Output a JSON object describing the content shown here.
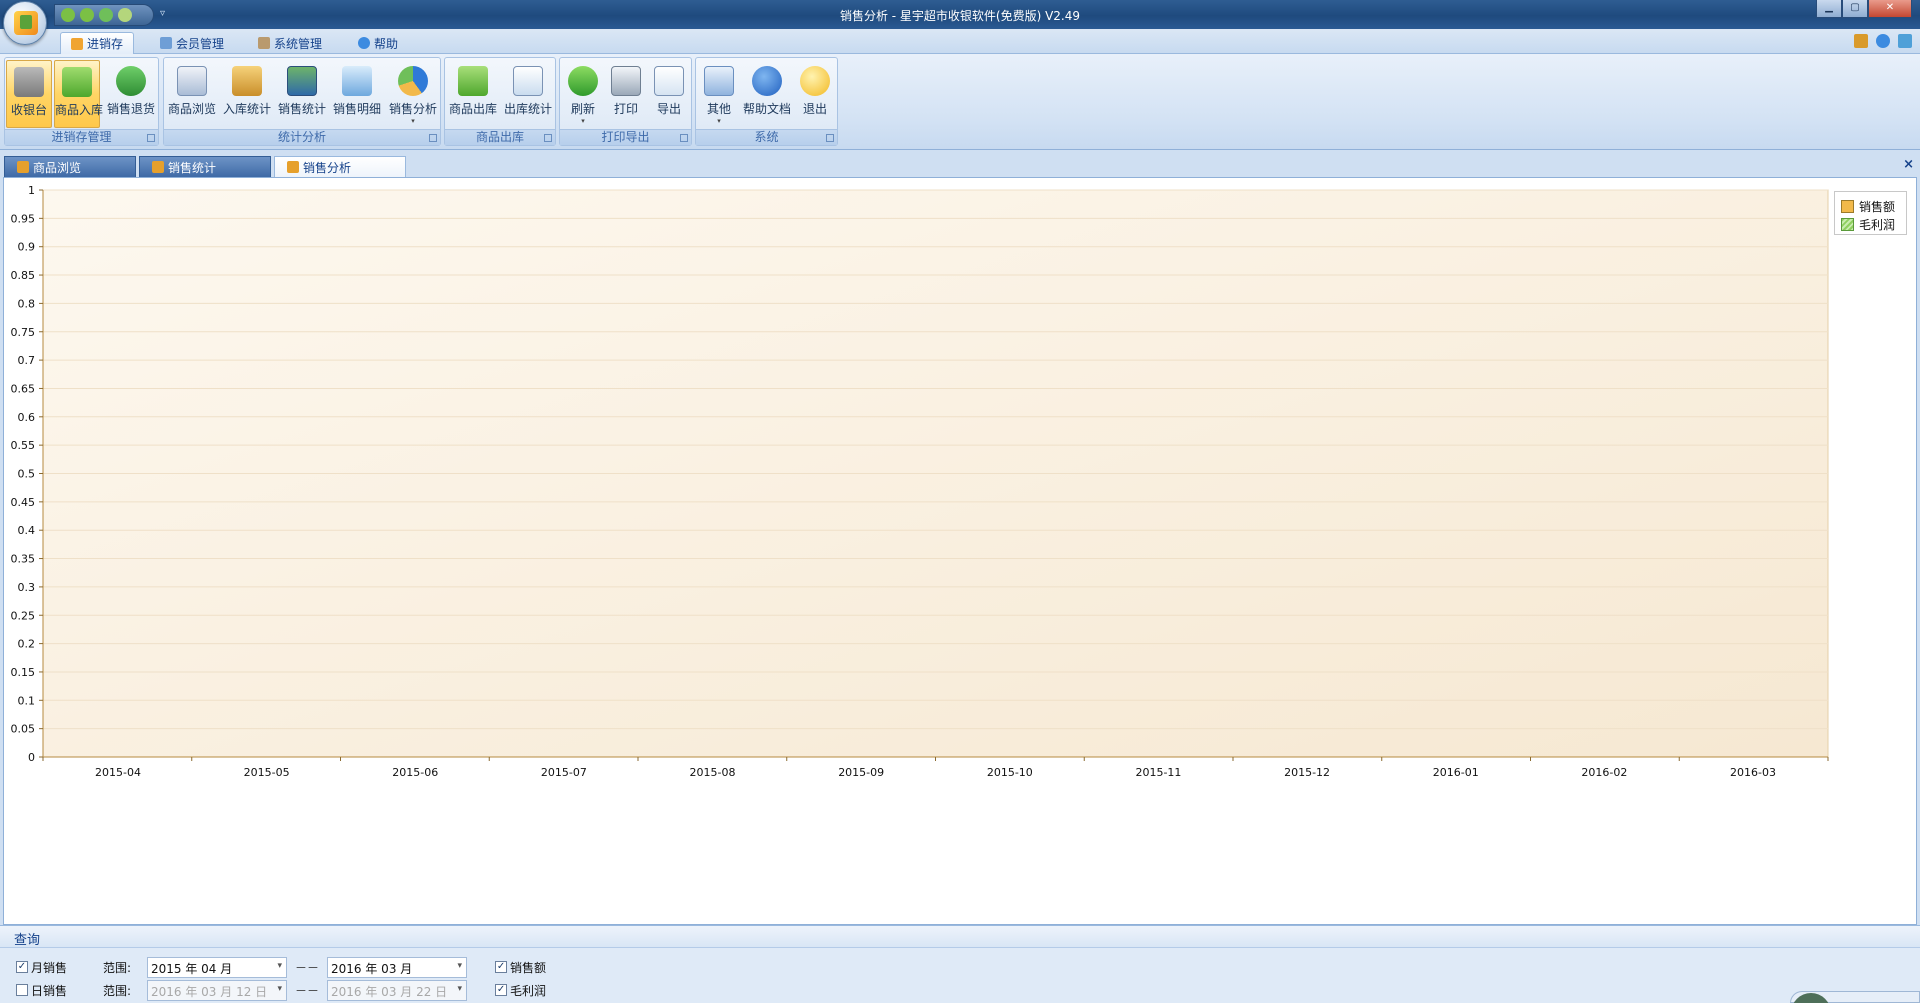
{
  "window": {
    "title": "销售分析 - 星宇超市收银软件(免费版) V2.49",
    "minimize": "▁",
    "maximize": "▢",
    "close": "✕",
    "qat_dropdown": "▿"
  },
  "ribbon_tabs": [
    "进销存",
    "会员管理",
    "系统管理",
    "帮助"
  ],
  "ribbon": {
    "groups": [
      {
        "label": "进销存管理",
        "buttons": [
          "收银台",
          "商品入库",
          "销售退货"
        ]
      },
      {
        "label": "统计分析",
        "buttons": [
          "商品浏览",
          "入库统计",
          "销售统计",
          "销售明细",
          "销售分析"
        ]
      },
      {
        "label": "商品出库",
        "buttons": [
          "商品出库",
          "出库统计"
        ]
      },
      {
        "label": "打印导出",
        "buttons": [
          "刷新",
          "打印",
          "导出"
        ]
      },
      {
        "label": "系统",
        "buttons": [
          "其他",
          "帮助文档",
          "退出"
        ]
      }
    ],
    "dropdown_arrow": "▾"
  },
  "doc_tabs": [
    "商品浏览",
    "销售统计",
    "销售分析"
  ],
  "doc_close": "×",
  "chart_data": {
    "type": "bar",
    "categories": [
      "2015-04",
      "2015-05",
      "2015-06",
      "2015-07",
      "2015-08",
      "2015-09",
      "2015-10",
      "2015-11",
      "2015-12",
      "2016-01",
      "2016-02",
      "2016-03"
    ],
    "series": [
      {
        "name": "销售额",
        "values": [
          0,
          0,
          0,
          0,
          0,
          0,
          0,
          0,
          0,
          0,
          0,
          0
        ],
        "color": "#f2b94a"
      },
      {
        "name": "毛利润",
        "values": [
          0,
          0,
          0,
          0,
          0,
          0,
          0,
          0,
          0,
          0,
          0,
          0
        ],
        "color": "#8fcf5f"
      }
    ],
    "ylim": [
      0,
      1
    ],
    "yticks": [
      "0",
      "0.05",
      "0.1",
      "0.15",
      "0.2",
      "0.25",
      "0.3",
      "0.35",
      "0.4",
      "0.45",
      "0.5",
      "0.55",
      "0.6",
      "0.65",
      "0.7",
      "0.75",
      "0.8",
      "0.85",
      "0.9",
      "0.95",
      "1"
    ],
    "grid": true,
    "legend": "top-right"
  },
  "query": {
    "header": "查询",
    "monthly_label": "月销售",
    "daily_label": "日销售",
    "range_label": "范围:",
    "dash": "－－",
    "month_start": "2015 年 04 月",
    "month_end": "2016 年 03 月",
    "day_start": "2016 年 03 月 12 日",
    "day_end": "2016 年 03 月 22 日",
    "sales_label": "销售额",
    "profit_label": "毛利润",
    "check_mark": "✓",
    "monthly_checked": true,
    "daily_checked": false,
    "sales_checked": true,
    "profit_checked": true
  }
}
